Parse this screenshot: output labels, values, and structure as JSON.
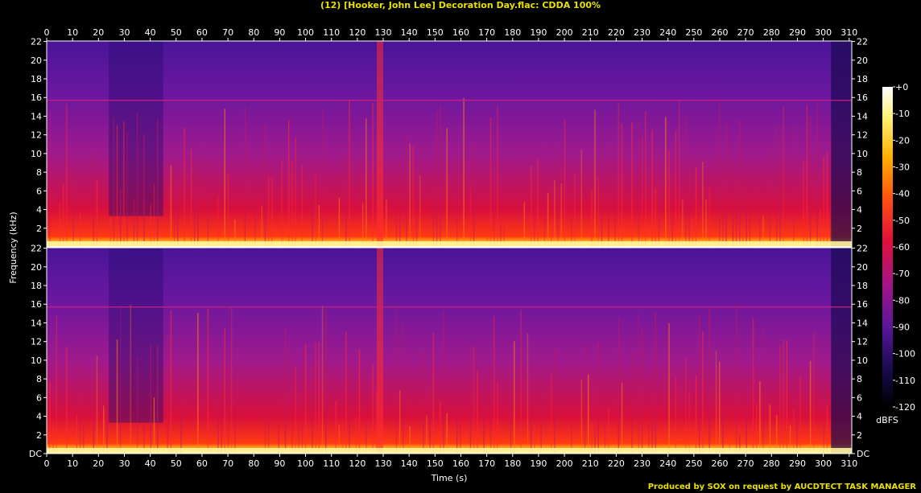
{
  "title": "(12) [Hooker, John Lee] Decoration Day.flac: CDDA 100%",
  "footer": "Produced by SOX on request by AUCDTECT TASK MANAGER",
  "chart_data": {
    "type": "heatmap",
    "xlabel": "Time (s)",
    "ylabel": "Frequency (kHz)",
    "colorbar_label": "dBFS",
    "xlim": [
      0,
      311
    ],
    "ylim": [
      0,
      22.05
    ],
    "x_ticks": [
      "0",
      "10",
      "20",
      "30",
      "40",
      "50",
      "60",
      "70",
      "80",
      "90",
      "100",
      "110",
      "120",
      "130",
      "140",
      "150",
      "160",
      "170",
      "180",
      "190",
      "200",
      "210",
      "220",
      "230",
      "240",
      "250",
      "260",
      "270",
      "280",
      "290",
      "300",
      "310"
    ],
    "y_ticks_top": [
      "22",
      "20",
      "18",
      "16",
      "14",
      "12",
      "10",
      "8",
      "6",
      "4",
      "2"
    ],
    "y_ticks_bottom": [
      "22",
      "20",
      "18",
      "16",
      "14",
      "12",
      "10",
      "8",
      "6",
      "4",
      "2",
      "DC"
    ],
    "y_tick_values": [
      22,
      20,
      18,
      16,
      14,
      12,
      10,
      8,
      6,
      4,
      2,
      0
    ],
    "colorbar_ticks": [
      "+0",
      "-10",
      "-20",
      "-30",
      "-40",
      "-50",
      "-60",
      "-70",
      "-80",
      "-90",
      "-100",
      "-110",
      "-120"
    ],
    "colorbar_range": [
      -120,
      0
    ],
    "channels": 2,
    "peak_line_khz": 15.7,
    "colors": {
      "low": "#000000",
      "mid1": "#2b0a6e",
      "mid2": "#8a1ba0",
      "mid3": "#e0103a",
      "high1": "#ff6a00",
      "high2": "#ffe040",
      "peak": "#ffffff",
      "axis": "#ffffff",
      "title": "#e8e000"
    }
  }
}
